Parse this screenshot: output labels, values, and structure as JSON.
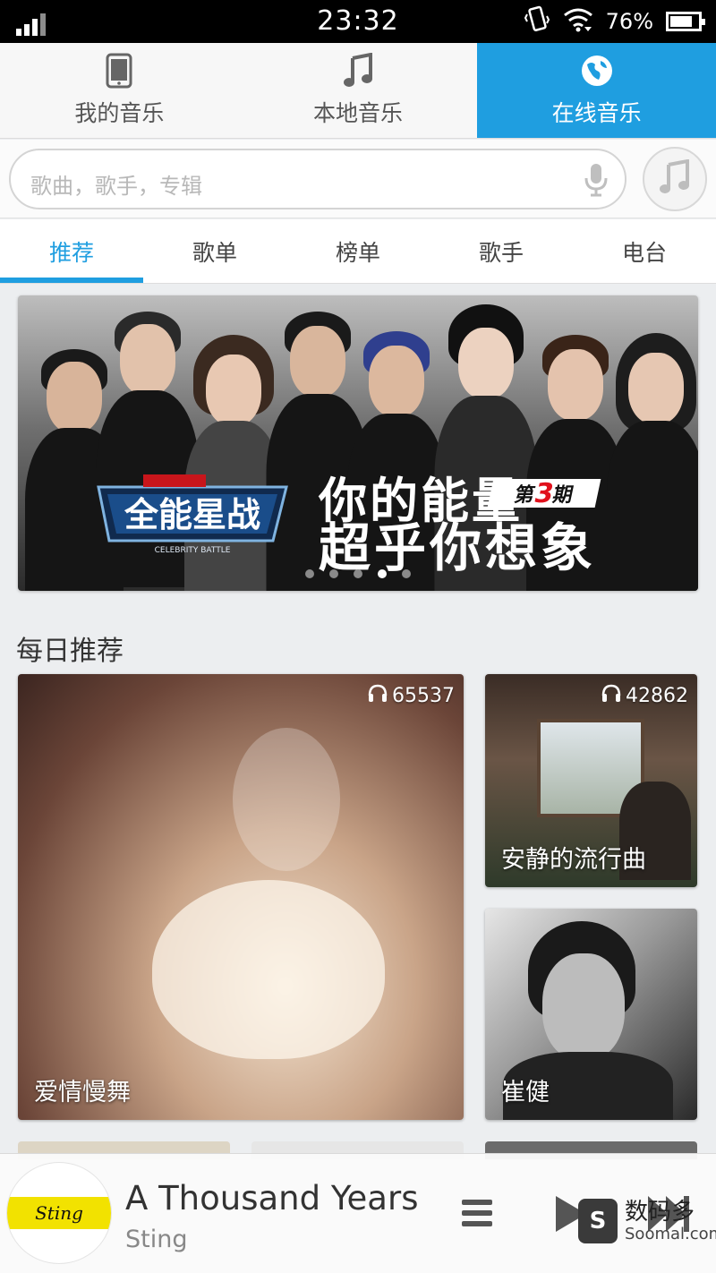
{
  "status_bar": {
    "time": "23:32",
    "battery": "76%"
  },
  "top_tabs": [
    {
      "label": "我的音乐",
      "icon": "phone-icon"
    },
    {
      "label": "本地音乐",
      "icon": "music-note-icon"
    },
    {
      "label": "在线音乐",
      "icon": "globe-icon",
      "active": true
    }
  ],
  "search": {
    "placeholder": "歌曲，歌手，专辑"
  },
  "sub_tabs": [
    {
      "label": "推荐",
      "active": true
    },
    {
      "label": "歌单"
    },
    {
      "label": "榜单"
    },
    {
      "label": "歌手"
    },
    {
      "label": "电台"
    }
  ],
  "banner": {
    "logo_text": "全能星战",
    "logo_subtext": "CELEBRITY BATTLE",
    "line1": "你的能量",
    "line2": "超乎你想象",
    "issue_prefix": "第",
    "issue_number": "3",
    "issue_suffix": "期",
    "dots_count": 5,
    "active_dot": 3
  },
  "section": {
    "title": "每日推荐"
  },
  "cards": [
    {
      "title": "爱情慢舞",
      "listens": "65537"
    },
    {
      "title": "安静的流行曲",
      "listens": "42862"
    },
    {
      "title": "崔健",
      "listens": ""
    }
  ],
  "player": {
    "song": "A Thousand Years",
    "artist": "Sting",
    "album_text": "Sting"
  },
  "watermark": {
    "cn": "数码多",
    "en": "Soomal.com"
  },
  "colors": {
    "accent": "#1f9ee0",
    "status_bar": "#000000"
  }
}
